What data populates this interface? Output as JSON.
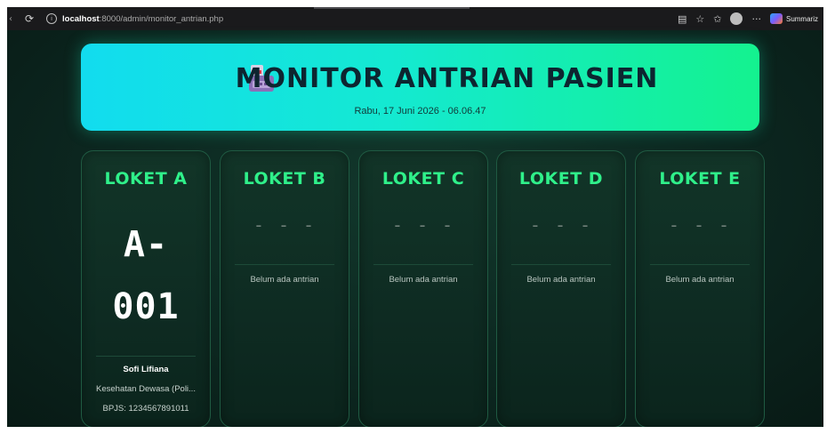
{
  "browser": {
    "host": "localhost",
    "path": ":8000/admin/monitor_antrian.php",
    "copilot_label": "Summariz",
    "icons": [
      "back-icon",
      "refresh-icon",
      "info-icon",
      "reader-icon",
      "favorite-icon",
      "collections-icon",
      "profile-icon",
      "more-icon",
      "copilot-icon"
    ]
  },
  "header": {
    "title": "MONITOR ANTRIAN PASIEN",
    "datetime": "Rabu, 17 Juni 2026 - 06.06.47",
    "gradient_start": "#12dcef",
    "gradient_end": "#14f28f"
  },
  "colors": {
    "accent": "#2ff08a",
    "background": "#0b1f19"
  },
  "counters": [
    {
      "title": "LOKET A",
      "number_line1": "A-",
      "number_line2": "001",
      "patient_name": "Sofi Lifiana",
      "service": "Kesehatan Dewasa (Poli...",
      "bpjs": "BPJS: 1234567891011"
    },
    {
      "title": "LOKET B",
      "placeholder": "- - -",
      "empty_text": "Belum ada antrian"
    },
    {
      "title": "LOKET C",
      "placeholder": "- - -",
      "empty_text": "Belum ada antrian"
    },
    {
      "title": "LOKET D",
      "placeholder": "- - -",
      "empty_text": "Belum ada antrian"
    },
    {
      "title": "LOKET E",
      "placeholder": "- - -",
      "empty_text": "Belum ada antrian"
    }
  ]
}
